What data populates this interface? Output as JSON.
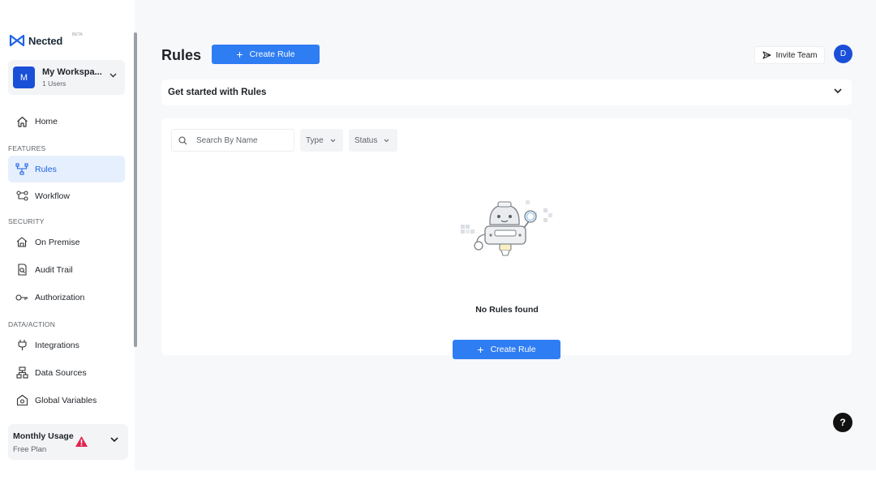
{
  "brand": {
    "name": "Nected",
    "badge": "BETA"
  },
  "workspace": {
    "initial": "M",
    "name": "My Workspa...",
    "users": "1 Users"
  },
  "sidebar": {
    "home": "Home",
    "sections": {
      "features": "FEATURES",
      "security": "SECURITY",
      "data_action": "DATA/ACTION"
    },
    "items": {
      "rules": "Rules",
      "workflow": "Workflow",
      "on_premise": "On Premise",
      "audit_trail": "Audit Trail",
      "authorization": "Authorization",
      "integrations": "Integrations",
      "data_sources": "Data Sources",
      "global_variables": "Global Variables"
    },
    "active_item": "rules"
  },
  "usage": {
    "title": "Monthly Usage",
    "plan": "Free Plan",
    "icon": "warning-icon"
  },
  "header": {
    "title": "Rules",
    "create_button": "Create Rule",
    "invite_button": "Invite Team",
    "user_initial": "D"
  },
  "getting_started": {
    "title": "Get started with Rules"
  },
  "filters": {
    "search_placeholder": "Search By Name",
    "type_label": "Type",
    "status_label": "Status"
  },
  "empty_state": {
    "message": "No Rules found",
    "create_button": "Create Rule"
  },
  "help": {
    "label": "?"
  },
  "colors": {
    "primary": "#2f7df2",
    "avatar": "#1a4fd8",
    "active_bg": "#e6effd",
    "warning": "#e0234e"
  }
}
